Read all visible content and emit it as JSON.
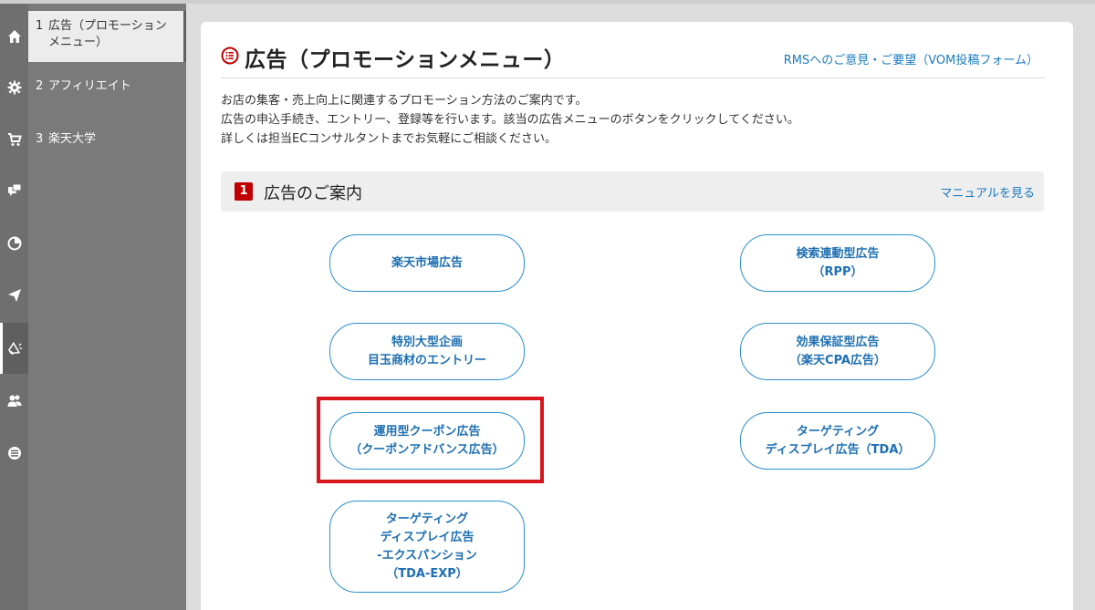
{
  "rail": {
    "icons": [
      "home-icon",
      "gear-icon",
      "cart-icon",
      "chat-icon",
      "pie-chart-icon",
      "paper-plane-icon",
      "megaphone-icon",
      "users-icon",
      "list-icon"
    ],
    "active_index": 6
  },
  "submenu": {
    "items": [
      {
        "num": "1",
        "label": "広告（プロモーション メニュー）"
      },
      {
        "num": "2",
        "label": "アフィリエイト"
      },
      {
        "num": "3",
        "label": "楽天大学"
      }
    ]
  },
  "header": {
    "title": "広告（プロモーションメニュー）",
    "feedback_link": "RMSへのご意見・ご要望（VOM投稿フォーム）"
  },
  "description": {
    "line1": "お店の集客・売上向上に関連するプロモーション方法のご案内です。",
    "line2": "広告の申込手続き、エントリー、登録等を行います。該当の広告メニューのボタンをクリックしてください。",
    "line3": "詳しくは担当ECコンサルタントまでお気軽にご相談ください。"
  },
  "section": {
    "badge": "1",
    "title": "広告のご案内",
    "manual_link": "マニュアルを見る"
  },
  "buttons": {
    "rakuten_ichiba_ad": "楽天市場広告",
    "rpp": "検索連動型広告\n（RPP）",
    "special_event": "特別大型企画\n目玉商材のエントリー",
    "cpa": "効果保証型広告\n（楽天CPA広告）",
    "coupon_advance": "運用型クーポン広告\n（クーポンアドバンス広告）",
    "tda": "ターゲティング\nディスプレイ広告（TDA）",
    "tda_exp": "ターゲティング\nディスプレイ広告\n-エクスパンション\n（TDA-EXP）"
  },
  "colors": {
    "accent": "#1e6fb2",
    "highlight": "#d9151e",
    "badge": "#c00000"
  }
}
